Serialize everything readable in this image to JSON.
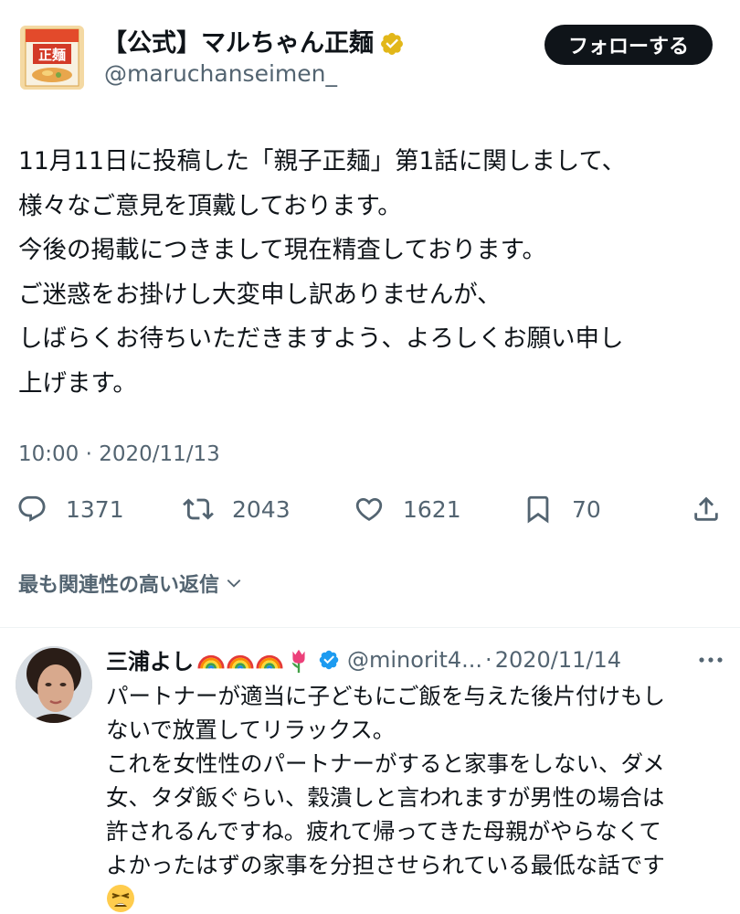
{
  "header": {
    "display_name": "【公式】マルちゃん正麺",
    "handle": "@maruchanseimen_",
    "follow_label": "フォローする",
    "verified_icon": "gold-verified-badge-icon",
    "colors": {
      "gold_badge": "#e2b719",
      "follow_bg": "#0f1419"
    }
  },
  "tweet": {
    "lines": [
      "11月11日に投稿した「親子正麺」第1話に関しまして、",
      "様々なご意見を頂戴しております。",
      "今後の掲載につきまして現在精査しております。",
      "ご迷惑をお掛けし大変申し訳ありませんが、",
      "しばらくお待ちいただきますよう、よろしくお願い申し",
      "上げます。"
    ],
    "meta": "10:00 · 2020/11/13"
  },
  "actions": {
    "replies": "1371",
    "retweets": "2043",
    "likes": "1621",
    "bookmarks": "70",
    "icons": [
      "reply-icon",
      "retweet-icon",
      "like-icon",
      "bookmark-icon",
      "share-icon"
    ]
  },
  "replies_filter": {
    "label": "最も関連性の高い返信"
  },
  "reply": {
    "name": "三浦よし",
    "emojis": [
      "rainbow-icon",
      "rainbow-icon",
      "rainbow-icon",
      "tulip-icon"
    ],
    "handle": "@minorit4...",
    "separator": "·",
    "date": "2020/11/14",
    "lines": [
      "パートナーが適当に子どもにご飯を与えた後片付けもし",
      "ないで放置してリラックス。",
      "これを女性性のパートナーがすると家事をしない、ダメ",
      "女、タダ飯ぐらい、穀潰しと言われますが男性の場合は",
      "許されるんですね。疲れて帰ってきた母親がやらなくて",
      "よかったはずの家事を分担させられている最低な話です"
    ],
    "trailing_emoji": "tired-face-emoji",
    "colors": {
      "blue_badge": "#1d9bf0"
    }
  }
}
